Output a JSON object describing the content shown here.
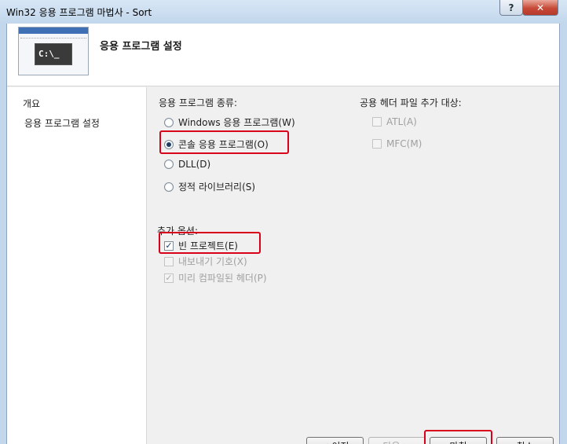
{
  "window": {
    "title": "Win32 응용 프로그램 마법사 - Sort",
    "help_label": "?",
    "close_label": "✕"
  },
  "header": {
    "title": "응용 프로그램 설정",
    "image_text": "C:\\_"
  },
  "sidebar": {
    "items": [
      {
        "label": "개요"
      },
      {
        "label": "응용 프로그램 설정"
      }
    ]
  },
  "app_type": {
    "label": "응용 프로그램 종류:",
    "options": [
      {
        "label": "Windows 응용 프로그램(W)",
        "checked": false
      },
      {
        "label": "콘솔 응용 프로그램(O)",
        "checked": true
      },
      {
        "label": "DLL(D)",
        "checked": false
      },
      {
        "label": "정적 라이브러리(S)",
        "checked": false
      }
    ]
  },
  "common_headers": {
    "label": "공용 헤더 파일 추가 대상:",
    "options": [
      {
        "label": "ATL(A)",
        "checked": false,
        "enabled": false
      },
      {
        "label": "MFC(M)",
        "checked": false,
        "enabled": false
      }
    ]
  },
  "extra_options": {
    "label": "추가 옵션:",
    "options": [
      {
        "label": "빈 프로젝트(E)",
        "checked": true,
        "enabled": true
      },
      {
        "label": "내보내기 기호(X)",
        "checked": false,
        "enabled": false
      },
      {
        "label": "미리 컴파일된 헤더(P)",
        "checked": true,
        "enabled": false
      }
    ]
  },
  "buttons": {
    "prev": "< 이전",
    "next": "다음 >",
    "finish": "마침",
    "cancel": "취소"
  },
  "check_mark": "✓",
  "colors": {
    "highlight": "#d9001a",
    "disabled_text": "#a0a0a0"
  }
}
